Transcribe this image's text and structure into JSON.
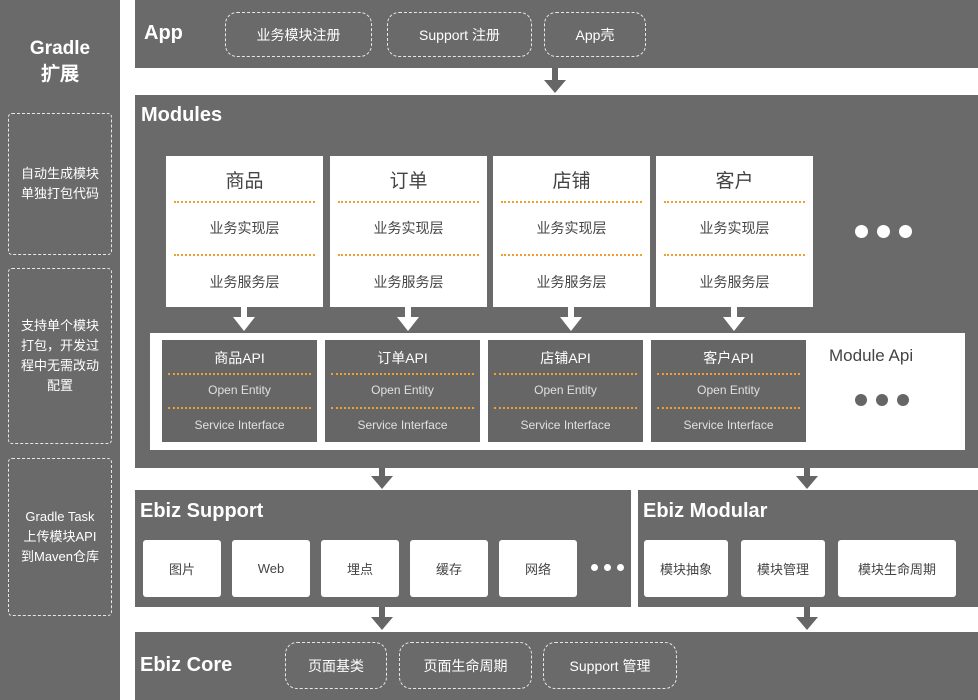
{
  "sidebar": {
    "title_line1": "Gradle",
    "title_line2": "扩展",
    "boxes": [
      {
        "line1": "自动生成模块",
        "line2": "单独打包代码"
      },
      {
        "line1": "支持单个模块",
        "line2": "打包，开发过",
        "line3": "程中无需改动",
        "line4": "配置"
      },
      {
        "line1": "Gradle Task",
        "line2": "上传模块API",
        "line3": "到Maven仓库"
      }
    ]
  },
  "app": {
    "title": "App",
    "items": [
      "业务模块注册",
      "Support 注册",
      "App壳"
    ]
  },
  "modules": {
    "title": "Modules",
    "cards": [
      {
        "name": "商品",
        "layer1": "业务实现层",
        "layer2": "业务服务层"
      },
      {
        "name": "订单",
        "layer1": "业务实现层",
        "layer2": "业务服务层"
      },
      {
        "name": "店铺",
        "layer1": "业务实现层",
        "layer2": "业务服务层"
      },
      {
        "name": "客户",
        "layer1": "业务实现层",
        "layer2": "业务服务层"
      }
    ],
    "module_api_label": "Module Api",
    "apis": [
      {
        "name": "商品API",
        "layer1": "Open Entity",
        "layer2": "Service Interface"
      },
      {
        "name": "订单API",
        "layer1": "Open Entity",
        "layer2": "Service Interface"
      },
      {
        "name": "店铺API",
        "layer1": "Open Entity",
        "layer2": "Service Interface"
      },
      {
        "name": "客户API",
        "layer1": "Open Entity",
        "layer2": "Service Interface"
      }
    ]
  },
  "ebiz_support": {
    "title": "Ebiz Support",
    "items": [
      "图片",
      "Web",
      "埋点",
      "缓存",
      "网络"
    ]
  },
  "ebiz_modular": {
    "title": "Ebiz Modular",
    "items": [
      "模块抽象",
      "模块管理",
      "模块生命周期"
    ]
  },
  "ebiz_core": {
    "title": "Ebiz Core",
    "items": [
      "页面基类",
      "页面生命周期",
      "Support 管理"
    ]
  },
  "colors": {
    "panel": "#6a6a6a",
    "api_box": "#666666",
    "separator": "#f0a030",
    "text_on_dark": "#ffffff",
    "text_on_light": "#444444"
  }
}
